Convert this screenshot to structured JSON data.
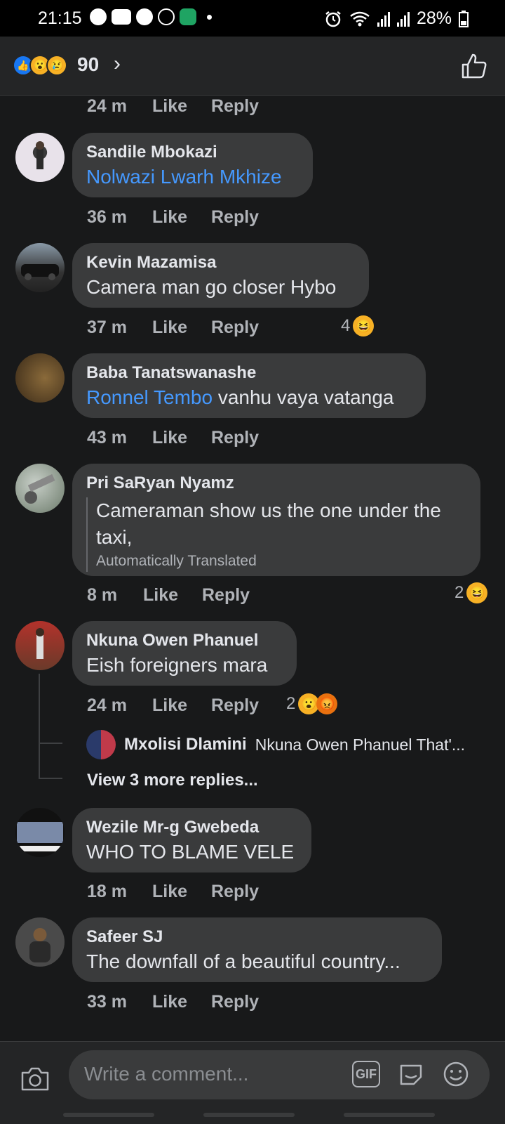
{
  "status": {
    "time": "21:15",
    "battery": "28%"
  },
  "topbar": {
    "reaction_count": "90"
  },
  "actions": {
    "like": "Like",
    "reply": "Reply"
  },
  "first_partial_time": "24 m",
  "comments": [
    {
      "name": "Sandile Mbokazi",
      "mention": "Nolwazi Lwarh Mkhize",
      "text": "",
      "time": "36 m"
    },
    {
      "name": "Kevin Mazamisa",
      "mention": "",
      "text": "Camera man go closer Hybo",
      "time": "37 m",
      "reactions": "4"
    },
    {
      "name": "Baba Tanatswanashe",
      "mention": "Ronnel Tembo",
      "text": " vanhu vaya vatanga",
      "time": "43 m"
    },
    {
      "name": "Pri SaRyan Nyamz",
      "text": "Cameraman show us the one under the taxi,",
      "translated_label": "Automatically Translated",
      "time": "8 m",
      "reactions": "2"
    },
    {
      "name": "Nkuna Owen Phanuel",
      "text": "Eish foreigners mara",
      "time": "24 m",
      "reactions": "2",
      "reply_preview": {
        "name": "Mxolisi Dlamini",
        "text": "Nkuna Owen Phanuel That'..."
      },
      "more_replies": "View 3 more replies..."
    },
    {
      "name": "Wezile Mr-g Gwebeda",
      "text": "WHO TO BLAME VELE",
      "time": "18 m"
    },
    {
      "name": "Safeer SJ",
      "text": "The downfall of a beautiful country...",
      "time": "33 m"
    }
  ],
  "composer": {
    "placeholder": "Write a comment...",
    "gif_label": "GIF"
  }
}
